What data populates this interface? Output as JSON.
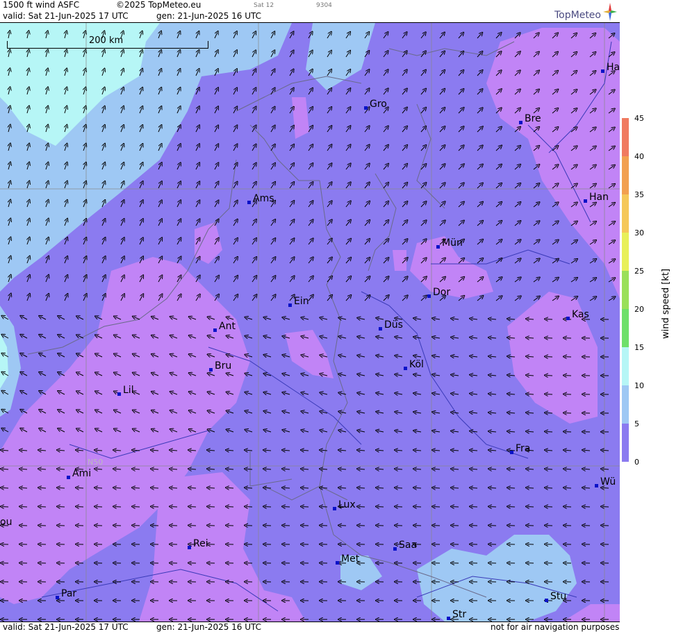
{
  "header": {
    "title": "1500 ft wind ASFC",
    "copyright": "©2025 TopMeteo.eu",
    "sat_label": "Sat 12",
    "code": "9304",
    "valid": "valid:  Sat  21-Jun-2025  17 UTC",
    "generated": "gen: 21-Jun-2025 16 UTC"
  },
  "logo": {
    "text": "TopMeteo"
  },
  "scale_bar": {
    "label": "200 km"
  },
  "latitude_label": "N50",
  "cities": [
    {
      "name": "Gro"
    },
    {
      "name": "Bre"
    },
    {
      "name": "Ha"
    },
    {
      "name": "Ams"
    },
    {
      "name": "Han"
    },
    {
      "name": "Mün"
    },
    {
      "name": "Dor"
    },
    {
      "name": "Ein"
    },
    {
      "name": "Kas"
    },
    {
      "name": "Ant"
    },
    {
      "name": "Düs"
    },
    {
      "name": "Bru"
    },
    {
      "name": "Köl"
    },
    {
      "name": "Lil"
    },
    {
      "name": "Fra"
    },
    {
      "name": "Ami"
    },
    {
      "name": "Wü"
    },
    {
      "name": "Lux"
    },
    {
      "name": "ou"
    },
    {
      "name": "Rei"
    },
    {
      "name": "Saa"
    },
    {
      "name": "Met"
    },
    {
      "name": "Par"
    },
    {
      "name": "Stu"
    },
    {
      "name": "Str"
    }
  ],
  "legend": {
    "label": "wind speed [kt]",
    "ticks": [
      "45",
      "40",
      "35",
      "30",
      "25",
      "20",
      "15",
      "10",
      "5",
      "0"
    ],
    "colors": [
      "#f07a60",
      "#f2a050",
      "#f5c85a",
      "#e8f05a",
      "#9ae05a",
      "#6ee06a",
      "#b6f6f6",
      "#9ec8f4",
      "#8b7bf0",
      "#c184f6"
    ]
  },
  "footer": {
    "valid": "valid:  Sat  21-Jun-2025  17 UTC",
    "generated": "gen: 21-Jun-2025 16 UTC",
    "disclaimer": "not for air navigation purposes"
  },
  "colors": {
    "calm": "#c184f6",
    "light": "#8b7bf0",
    "moderate": "#9ec8f4",
    "fresh": "#b6f6f6"
  }
}
